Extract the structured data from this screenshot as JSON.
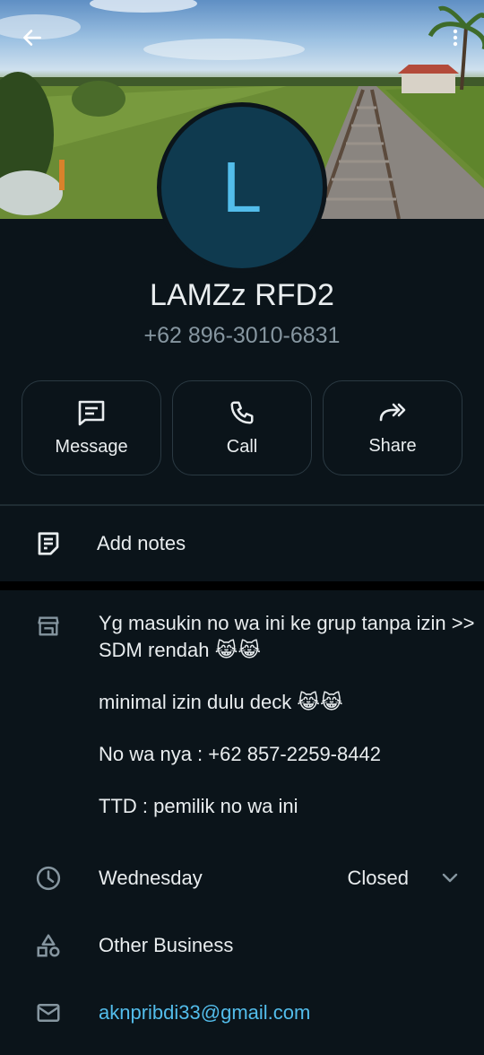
{
  "header": {
    "back_icon": "arrow-left-icon",
    "menu_icon": "more-vert-icon",
    "cover_description_icon": "railway-landscape"
  },
  "profile": {
    "initial": "L",
    "name": "LAMZz RFD2",
    "phone": "+62 896-3010-6831",
    "avatar_color": "#0f3a4f",
    "initial_color": "#53bdeb"
  },
  "actions": [
    {
      "label": "Message",
      "icon": "message-icon"
    },
    {
      "label": "Call",
      "icon": "phone-icon"
    },
    {
      "label": "Share",
      "icon": "share-icon"
    }
  ],
  "notes": {
    "label": "Add notes",
    "icon": "notes-icon"
  },
  "about": {
    "icon": "store-icon",
    "lines": [
      "Yg masukin no wa ini ke grup tanpa izin >> SDM rendah 😹😹",
      "minimal izin dulu deck 😹😹",
      "No wa nya : +62 857-2259-8442",
      "TTD : pemilik no wa ini"
    ]
  },
  "hours": {
    "day": "Wednesday",
    "status": "Closed",
    "icon": "clock-icon"
  },
  "category": {
    "label": "Other Business",
    "icon": "category-icon"
  },
  "email": {
    "address": "aknpribdi33@gmail.com",
    "icon": "mail-icon"
  },
  "colors": {
    "background": "#0b141a",
    "accent": "#53bdeb",
    "muted": "#8696a0"
  }
}
